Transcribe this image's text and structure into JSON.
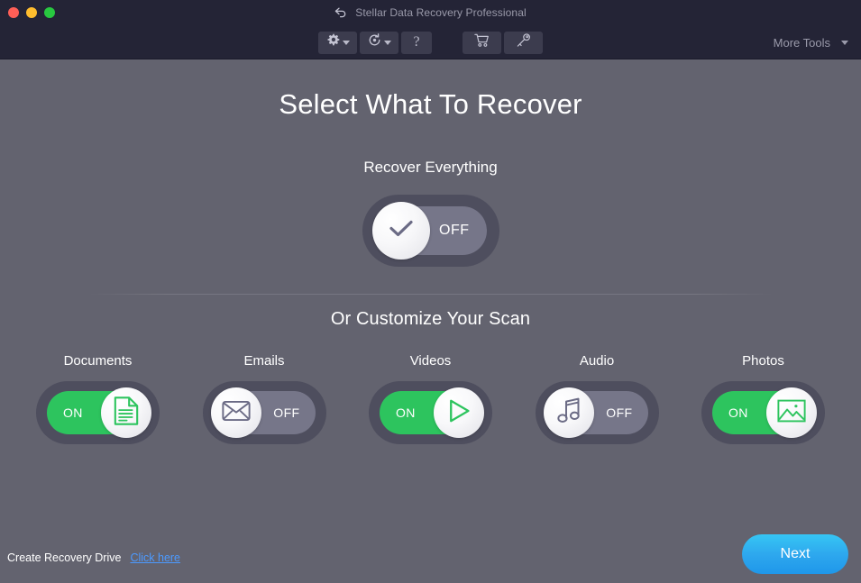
{
  "window": {
    "title": "Stellar Data Recovery Professional",
    "traffic_lights": [
      "close",
      "minimize",
      "maximize"
    ],
    "back_icon": "back-arrow-icon"
  },
  "toolbar": {
    "groups": [
      {
        "buttons": [
          {
            "name": "settings",
            "icon": "gear-icon",
            "has_caret": true
          },
          {
            "name": "history",
            "icon": "history-icon",
            "has_caret": true
          },
          {
            "name": "help",
            "icon": "question-mark-icon",
            "label": "?",
            "has_caret": false
          }
        ]
      },
      {
        "buttons": [
          {
            "name": "buy",
            "icon": "shopping-cart-icon",
            "has_caret": false
          },
          {
            "name": "activate",
            "icon": "key-icon",
            "has_caret": false
          }
        ]
      }
    ],
    "more_tools_label": "More Tools"
  },
  "main": {
    "page_title": "Select What To Recover",
    "recover_everything_label": "Recover Everything",
    "recover_everything_state": "OFF",
    "recover_everything_icon": "checkmark-icon",
    "customize_label": "Or Customize Your Scan",
    "categories": [
      {
        "label": "Documents",
        "state": "ON",
        "icon": "document-icon"
      },
      {
        "label": "Emails",
        "state": "OFF",
        "icon": "envelope-icon"
      },
      {
        "label": "Videos",
        "state": "ON",
        "icon": "play-triangle-icon"
      },
      {
        "label": "Audio",
        "state": "OFF",
        "icon": "music-note-icon"
      },
      {
        "label": "Photos",
        "state": "ON",
        "icon": "image-icon"
      }
    ]
  },
  "footer": {
    "recovery_drive_label": "Create Recovery Drive",
    "recovery_drive_link": "Click here",
    "next_label": "Next"
  },
  "colors": {
    "titlebar_bg": "#242436",
    "content_bg": "#63636f",
    "toggle_outer": "#4e4e5e",
    "toggle_off_track": "#767689",
    "toggle_on_track": "#2dc45e",
    "accent_green": "#2dc45e",
    "accent_blue": "#2ea8ee",
    "link_blue": "#4c9aff",
    "icon_gray": "#6b6b85"
  }
}
